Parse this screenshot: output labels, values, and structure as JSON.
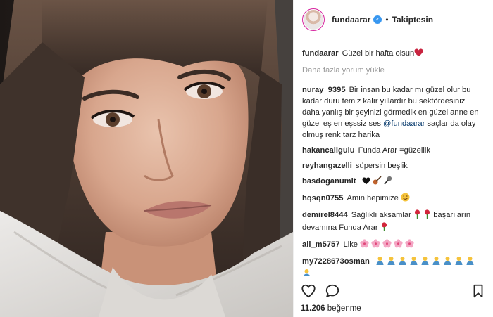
{
  "header": {
    "username": "fundaarar",
    "verified_icon": "verified-badge-icon",
    "separator": "•",
    "follow_label": "Takiptesin"
  },
  "caption": {
    "username": "fundaarar",
    "text": "Güzel bir hafta olsun"
  },
  "load_more_label": "Daha fazla yorum yükle",
  "comments": [
    {
      "user": "nuray_9395",
      "text_before": "Bir insan bu kadar mı güzel olur bu kadar duru temiz kalır yıllardır bu sektördesiniz daha yanlış bir şeyinizi görmedik en güzel anne en güzel eş en eşssiz ses",
      "mention": "@fundaarar",
      "text_after": "saçlar da olay olmuş renk tarz harika"
    },
    {
      "user": "hakancaligulu",
      "text": "Funda Arar =güzellik"
    },
    {
      "user": "reyhangazelli",
      "text": "süpersin beşlik"
    },
    {
      "user": "basdoganumit",
      "text": ""
    },
    {
      "user": "hqsqn0755",
      "text": "Amin hepimize"
    },
    {
      "user": "demirel8444",
      "text_before": "Sağlıklı aksamlar",
      "text_after": "başarıların devamına Funda Arar"
    },
    {
      "user": "ali_m5757",
      "text": "Like"
    },
    {
      "user": "my7228673osman",
      "text": ""
    }
  ],
  "actions": {
    "like_icon": "heart-icon",
    "comment_icon": "comment-icon",
    "save_icon": "bookmark-icon"
  },
  "likes": {
    "count": "11.206",
    "label": "beğenme"
  },
  "colors": {
    "text": "#262626",
    "muted": "#999999",
    "verified": "#3897f0",
    "border": "#efefef",
    "mention": "#003569"
  }
}
